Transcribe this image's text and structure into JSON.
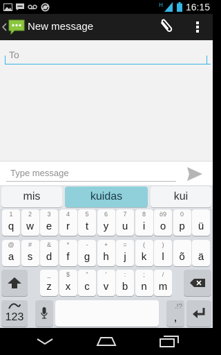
{
  "status_bar": {
    "time": "16:15",
    "left_icons": [
      "image-icon",
      "sms-icon",
      "voicemail-icon",
      "sync-icon"
    ],
    "signal_label": "H"
  },
  "action_bar": {
    "title": "New message"
  },
  "compose": {
    "to_placeholder": "To",
    "message_placeholder": "Type message"
  },
  "keyboard": {
    "suggestions": [
      "mis",
      "kuidas",
      "kui"
    ],
    "row1": [
      {
        "main": "q",
        "alt": "1"
      },
      {
        "main": "w",
        "alt": "2"
      },
      {
        "main": "e",
        "alt": "3"
      },
      {
        "main": "r",
        "alt": "4"
      },
      {
        "main": "t",
        "alt": "5"
      },
      {
        "main": "y",
        "alt": "6"
      },
      {
        "main": "u",
        "alt": "7"
      },
      {
        "main": "i",
        "alt": "8"
      },
      {
        "main": "o",
        "alt": "9"
      },
      {
        "main": "p",
        "alt": "0"
      },
      {
        "main": "ü",
        "alt": ""
      }
    ],
    "row1_o_alt": "ö9",
    "row2": [
      {
        "main": "a",
        "alt": "@"
      },
      {
        "main": "s",
        "alt": "#"
      },
      {
        "main": "d",
        "alt": "&"
      },
      {
        "main": "f",
        "alt": "*"
      },
      {
        "main": "g",
        "alt": "-"
      },
      {
        "main": "h",
        "alt": "+"
      },
      {
        "main": "j",
        "alt": "="
      },
      {
        "main": "k",
        "alt": "("
      },
      {
        "main": "l",
        "alt": ")"
      },
      {
        "main": "õ",
        "alt": ""
      },
      {
        "main": "ä",
        "alt": ""
      }
    ],
    "row3": [
      {
        "main": "z",
        "alt": "_"
      },
      {
        "main": "x",
        "alt": "$"
      },
      {
        "main": "c",
        "alt": "\""
      },
      {
        "main": "v",
        "alt": "'"
      },
      {
        "main": "b",
        "alt": ":"
      },
      {
        "main": "n",
        "alt": ";"
      },
      {
        "main": "m",
        "alt": "/"
      }
    ],
    "numbers_key": "123",
    "punct_key_main": ",",
    "punct_key_alt": ".!?",
    "colors": {
      "suggestion_highlight": "#8fd0db",
      "accent": "#33b5e5"
    }
  }
}
